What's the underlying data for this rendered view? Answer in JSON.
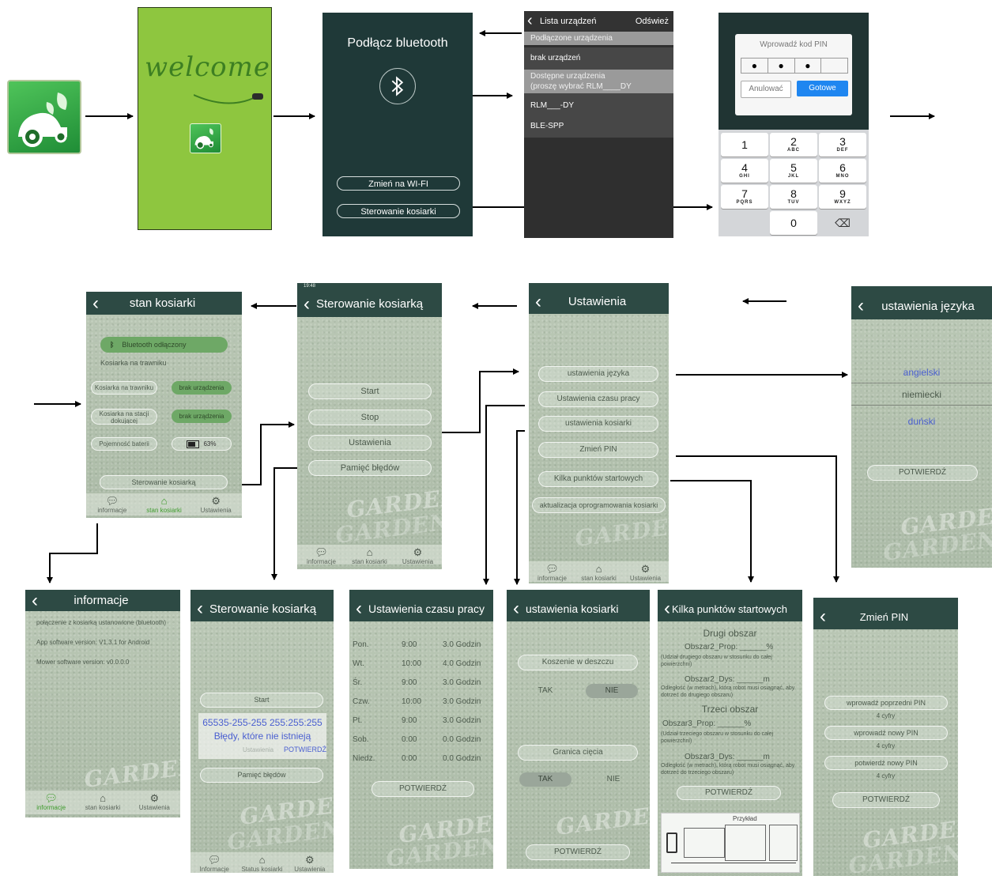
{
  "splash": {
    "welcome": "welcome"
  },
  "bt_connect": {
    "title": "Podłącz bluetooth",
    "wifi_button": "Zmień na WI-FI",
    "mower_button": "Sterowanie kosiarki"
  },
  "device_list": {
    "title": "Lista urządzeń",
    "refresh": "Odśwież",
    "connected_header": "Podłączone urządzenia",
    "no_devices": "brak urządzeń",
    "available_header_1": "Dostępne urządzenia",
    "available_header_2": "(proszę wybrać RLM____DY",
    "device_1": "RLM___-DY",
    "device_2": "BLE-SPP"
  },
  "pin_dialog": {
    "title": "Wprowadź kod PIN",
    "cancel": "Anulować",
    "done": "Gotowe",
    "keys": [
      {
        "n": "1",
        "l": ""
      },
      {
        "n": "2",
        "l": "ABC"
      },
      {
        "n": "3",
        "l": "DEF"
      },
      {
        "n": "4",
        "l": "GHI"
      },
      {
        "n": "5",
        "l": "JKL"
      },
      {
        "n": "6",
        "l": "MNO"
      },
      {
        "n": "7",
        "l": "PQRS"
      },
      {
        "n": "8",
        "l": "TUV"
      },
      {
        "n": "9",
        "l": "WXYZ"
      },
      {
        "n": "0",
        "l": ""
      }
    ],
    "delete_key": "⌫"
  },
  "tabs": {
    "info": "informacje",
    "state": "stan kosiarki",
    "settings": "Ustawienia",
    "status": "Status kosiarki",
    "info_cap": "Informacje"
  },
  "stan": {
    "title": "stan kosiarki",
    "bt_status": "Bluetooth odłączony",
    "mower_location": "Kosiarka na trawniku",
    "row1_label": "Kosiarka na trawniku",
    "row1_value": "brak urządzenia",
    "row2_label": "Kosiarka na stacji dokującej",
    "row2_value": "brak urządzenia",
    "row3_label": "Pojemność baterii",
    "row3_value": "63%",
    "button": "Sterowanie kosiarką"
  },
  "sterowanie": {
    "title": "Sterowanie kosiarką",
    "start": "Start",
    "stop": "Stop",
    "settings": "Ustawienia",
    "errors": "Pamięć błędów"
  },
  "ustawienia": {
    "title": "Ustawienia",
    "lang": "ustawienia języka",
    "work_time": "Ustawienia czasu pracy",
    "mower": "ustawienia kosiarki",
    "pin": "Zmień PIN",
    "start_points": "Kilka punktów startowych",
    "firmware": "aktualizacja oprogramowania kosiarki"
  },
  "jezyk": {
    "title": "ustawienia języka",
    "lang1": "angielski",
    "lang2": "niemiecki",
    "lang3": "duński",
    "confirm": "POTWIERDŹ"
  },
  "informacje": {
    "title": "informacje",
    "line1": "połączenie z kosiarką ustanowione (bluetooth)",
    "line2": "App software version: V1.3.1 for Android",
    "line3": "Mower software version: v0.0.0.0"
  },
  "sterowanie2": {
    "title": "Sterowanie kosiarką",
    "start": "Start",
    "code": "65535-255-255 255:255:255",
    "error_msg": "Błędy, które nie istnieją",
    "settings": "Ustawienia",
    "confirm": "POTWIERDŹ",
    "errors": "Pamięć błędów"
  },
  "czas": {
    "title": "Ustawienia czasu pracy",
    "rows": [
      {
        "day": "Pon.",
        "time": "9:00",
        "dur": "3.0 Godzin"
      },
      {
        "day": "Wt.",
        "time": "10:00",
        "dur": "4.0 Godzin"
      },
      {
        "day": "Śr.",
        "time": "9:00",
        "dur": "3.0 Godzin"
      },
      {
        "day": "Czw.",
        "time": "10:00",
        "dur": "3.0 Godzin"
      },
      {
        "day": "Pt.",
        "time": "9:00",
        "dur": "3.0 Godzin"
      },
      {
        "day": "Sob.",
        "time": "0:00",
        "dur": "0.0 Godzin"
      },
      {
        "day": "Niedz.",
        "time": "0:00",
        "dur": "0.0 Godzin"
      }
    ],
    "confirm": "POTWIERDŹ"
  },
  "kosiarka": {
    "title": "ustawienia kosiarki",
    "rain": "Koszenie w deszczu",
    "yes": "TAK",
    "no": "NIE",
    "boundary": "Granica cięcia",
    "confirm": "POTWIERDŹ"
  },
  "punkty": {
    "title": "Kilka punktów startowych",
    "area2": "Drugi obszar",
    "a2_prop": "Obszar2_Prop: ______%",
    "a2_prop_desc": "(Udział drugiego obszaru w stosunku do całej powierzchni)",
    "a2_dys": "Obszar2_Dys: ______m",
    "a2_dys_desc": "Odległość (w metrach), którą robot musi osiągnąć, aby dotrzeć do drugiego obszaru)",
    "area3": "Trzeci obszar",
    "a3_prop": "Obszar3_Prop: ______%",
    "a3_prop_desc": "(Udział trzeciego obszaru w stosunku do całej powierzchni)",
    "a3_dys": "Obszar3_Dys: ______m",
    "a3_dys_desc": "Odległość (w metrach), którą robot musi osiągnąć, aby dotrzeć do trzeciego obszaru)",
    "confirm": "POTWIERDŹ",
    "example": "Przykład"
  },
  "pin": {
    "title": "Zmień PIN",
    "old": "wprowadź poprzedni PIN",
    "new": "wprowadź nowy PIN",
    "confirm_new": "potwierdź nowy PIN",
    "hint": "4 cyfry",
    "confirm": "POTWIERDŹ"
  },
  "watermark": {
    "garden": "GARDEN"
  },
  "colors": {
    "header": "#2d4a44",
    "accent_green": "#3e9b2c",
    "pin_blue": "#1f86f0",
    "link_blue": "#4a5fd0"
  },
  "icons": {
    "back": "chevron-left-icon",
    "bluetooth": "bluetooth-icon",
    "home": "home-icon",
    "gear": "gear-icon",
    "chat": "chat-icon",
    "battery": "battery-icon"
  }
}
